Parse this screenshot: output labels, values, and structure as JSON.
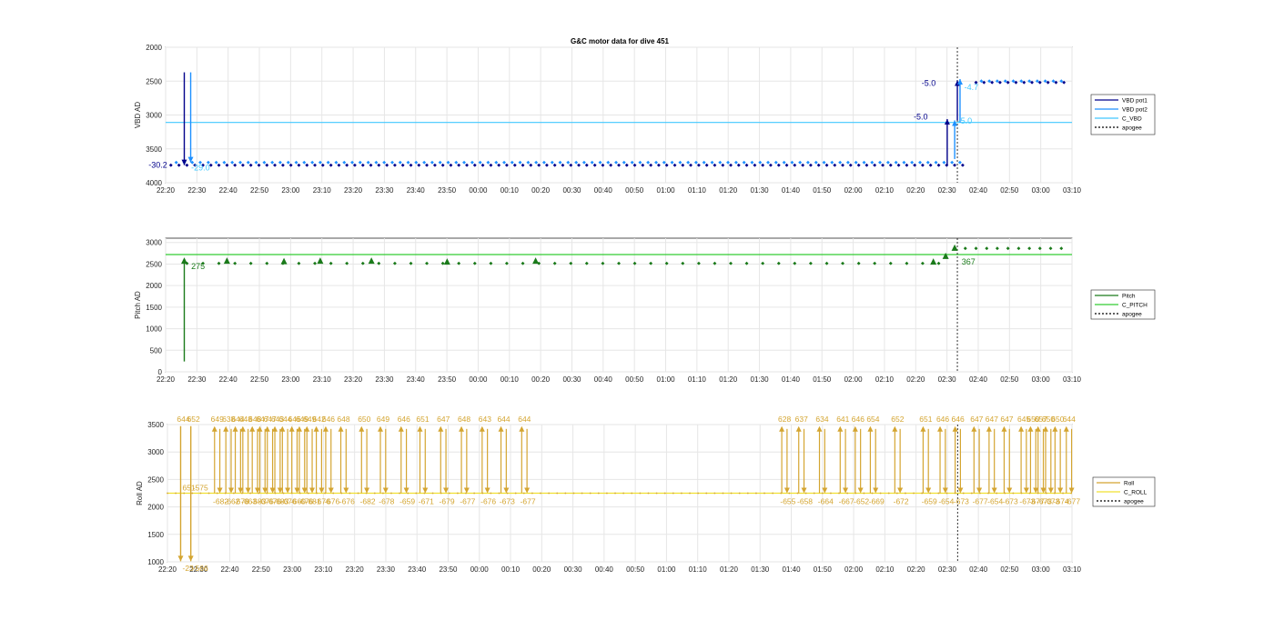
{
  "figure_title": "G&C motor data for dive 451",
  "colors": {
    "vbd_pot1": "#00008b",
    "vbd_pot2": "#1e90ff",
    "c_vbd": "#40c8ff",
    "pitch": "#1a7a1a",
    "c_pitch": "#33cc33",
    "roll": "#d4a531",
    "c_roll": "#f0e030",
    "apogee": "#000000"
  },
  "chart_data": [
    {
      "type": "scatter",
      "id": "vbd",
      "title": "G&C motor data for dive 451",
      "ylabel": "VBD AD",
      "ylim": [
        2000,
        4000
      ],
      "y_reversed": true,
      "y_ticks": [
        "2000",
        "2500",
        "3000",
        "3500",
        "4000"
      ],
      "x_ticks": [
        "22:20",
        "22:30",
        "22:40",
        "22:50",
        "23:00",
        "23:10",
        "23:20",
        "23:30",
        "23:40",
        "23:50",
        "00:00",
        "00:10",
        "00:20",
        "00:30",
        "00:40",
        "00:50",
        "01:00",
        "01:10",
        "01:20",
        "01:30",
        "01:40",
        "01:50",
        "02:00",
        "02:10",
        "02:20",
        "02:30",
        "02:40",
        "02:50",
        "03:00",
        "03:10"
      ],
      "xlim_minutes": [
        0,
        170
      ],
      "apogee_minutes": 148.5,
      "legend": [
        {
          "label": "VBD pot1",
          "color": "#00008b",
          "dash": ""
        },
        {
          "label": "VBD pot2",
          "color": "#1e90ff",
          "dash": ""
        },
        {
          "label": "C_VBD",
          "color": "#40c8ff",
          "dash": ""
        },
        {
          "label": "apogee",
          "color": "#000000",
          "dash": "2,2"
        }
      ],
      "hline": {
        "name": "C_VBD",
        "value": 3110,
        "color": "#40c8ff"
      },
      "series": [
        {
          "name": "VBD pot1",
          "color": "#00008b",
          "segments": [
            {
              "x": [
                1,
                150
              ],
              "y": 3730,
              "step": 1.5
            },
            {
              "x": [
                152,
                169
              ],
              "y": 2510,
              "step": 1.5
            }
          ]
        },
        {
          "name": "VBD pot2",
          "color": "#1e90ff",
          "segments": [
            {
              "x": [
                2,
                149
              ],
              "y": 3690,
              "step": 1.5
            },
            {
              "x": [
                153,
                169
              ],
              "y": 2490,
              "step": 1.5
            }
          ]
        }
      ],
      "arrows": [
        {
          "x": 3.5,
          "y0": 2370,
          "y1": 3740,
          "color": "#00008b",
          "head": "down"
        },
        {
          "x": 4.7,
          "y0": 2370,
          "y1": 3700,
          "color": "#1e90ff",
          "head": "down"
        },
        {
          "x": 146.6,
          "y0": 3740,
          "y1": 3060,
          "color": "#00008b",
          "head": "up"
        },
        {
          "x": 148.0,
          "y0": 3650,
          "y1": 3080,
          "color": "#1e90ff",
          "head": "up"
        },
        {
          "x": 148.5,
          "y0": 3080,
          "y1": 2490,
          "color": "#00008b",
          "head": "up"
        },
        {
          "x": 149.0,
          "y0": 3110,
          "y1": 2470,
          "color": "#1e90ff",
          "head": "up"
        }
      ],
      "labels": [
        {
          "text": "-30.2",
          "x": -3.2,
          "y": 3780,
          "color": "#00008b"
        },
        {
          "text": "-29.0",
          "x": 4.8,
          "y": 3820,
          "color": "#40c8ff"
        },
        {
          "text": "-5.0",
          "x": 140.3,
          "y": 3070,
          "color": "#00008b"
        },
        {
          "text": "-5.0",
          "x": 148.6,
          "y": 3130,
          "color": "#40c8ff"
        },
        {
          "text": "-5.0",
          "x": 141.8,
          "y": 2570,
          "color": "#00008b"
        },
        {
          "text": "-4.7",
          "x": 149.8,
          "y": 2630,
          "color": "#40c8ff"
        }
      ]
    },
    {
      "type": "scatter",
      "id": "pitch",
      "title": "",
      "ylabel": "Pitch AD",
      "ylim": [
        0,
        3100
      ],
      "y_reversed": false,
      "y_ticks": [
        "0",
        "500",
        "1000",
        "1500",
        "2000",
        "2500",
        "3000"
      ],
      "x_ticks": [
        "22:20",
        "22:30",
        "22:40",
        "22:50",
        "23:00",
        "23:10",
        "23:20",
        "23:30",
        "23:40",
        "23:50",
        "00:00",
        "00:10",
        "00:20",
        "00:30",
        "00:40",
        "00:50",
        "01:00",
        "01:10",
        "01:20",
        "01:30",
        "01:40",
        "01:50",
        "02:00",
        "02:10",
        "02:20",
        "02:30",
        "02:40",
        "02:50",
        "03:00",
        "03:10"
      ],
      "xlim_minutes": [
        0,
        170
      ],
      "apogee_minutes": 148.5,
      "legend": [
        {
          "label": "Pitch",
          "color": "#1a7a1a",
          "dash": ""
        },
        {
          "label": "C_PITCH",
          "color": "#33cc33",
          "dash": ""
        },
        {
          "label": "apogee",
          "color": "#000000",
          "dash": "2,2"
        }
      ],
      "hline": {
        "name": "C_PITCH",
        "value": 2720,
        "color": "#33cc33"
      },
      "series": [
        {
          "name": "Pitch",
          "color": "#1a7a1a",
          "segments": [
            {
              "x": [
                4,
                146
              ],
              "y": 2530,
              "step": 3
            },
            {
              "x": [
                150,
                169
              ],
              "y": 2880,
              "step": 2
            }
          ]
        }
      ],
      "triangles": [
        {
          "x": 3.5,
          "y": 2570
        },
        {
          "x": 11.5,
          "y": 2570
        },
        {
          "x": 22.2,
          "y": 2560
        },
        {
          "x": 29,
          "y": 2570
        },
        {
          "x": 38.6,
          "y": 2570
        },
        {
          "x": 52.8,
          "y": 2550
        },
        {
          "x": 69.4,
          "y": 2570
        },
        {
          "x": 144,
          "y": 2550
        },
        {
          "x": 146.3,
          "y": 2680
        },
        {
          "x": 148,
          "y": 2870
        }
      ],
      "arrows": [
        {
          "x": 3.5,
          "y0": 240,
          "y1": 2530,
          "color": "#1a7a1a",
          "head": "none"
        }
      ],
      "labels": [
        {
          "text": "275",
          "x": 4.8,
          "y": 2380,
          "color": "#1a7a1a"
        },
        {
          "text": "367",
          "x": 149.3,
          "y": 2490,
          "color": "#1a7a1a"
        }
      ]
    },
    {
      "type": "scatter",
      "id": "roll",
      "title": "",
      "ylabel": "Roll AD",
      "ylim": [
        1000,
        3500
      ],
      "y_reversed": false,
      "y_ticks": [
        "1000",
        "1500",
        "2000",
        "2500",
        "3000",
        "3500"
      ],
      "x_ticks": [
        "22:20",
        "22:30",
        "22:40",
        "22:50",
        "23:00",
        "23:10",
        "23:20",
        "23:30",
        "23:40",
        "23:50",
        "00:00",
        "00:10",
        "00:20",
        "00:30",
        "00:40",
        "00:50",
        "01:00",
        "01:10",
        "01:20",
        "01:30",
        "01:40",
        "01:50",
        "02:00",
        "02:10",
        "02:20",
        "02:30",
        "02:40",
        "02:50",
        "03:00",
        "03:10"
      ],
      "xlim_minutes": [
        0,
        170
      ],
      "apogee_minutes": 148.5,
      "legend": [
        {
          "label": "Roll",
          "color": "#d4a531",
          "dash": ""
        },
        {
          "label": "C_ROLL",
          "color": "#f0e030",
          "dash": ""
        },
        {
          "label": "apogee",
          "color": "#000000",
          "dash": "2,2"
        }
      ],
      "hline": {
        "name": "C_ROLL",
        "value": 2250,
        "color": "#f0e030"
      },
      "baseline": 2250,
      "roll_pairs": [
        {
          "x": 12.5,
          "pos": "649",
          "neg": "-682"
        },
        {
          "x": 15.5,
          "pos": "638",
          "neg": "-662"
        },
        {
          "x": 18,
          "pos": "644",
          "neg": "-678"
        },
        {
          "x": 20,
          "pos": "648",
          "neg": "-663"
        },
        {
          "x": 22.5,
          "pos": "648",
          "neg": "-683"
        },
        {
          "x": 24.5,
          "pos": "647",
          "neg": "-676"
        },
        {
          "x": 26.5,
          "pos": "647",
          "neg": "-676"
        },
        {
          "x": 28.5,
          "pos": "643",
          "neg": "-683"
        },
        {
          "x": 30.5,
          "pos": "644",
          "neg": "-676"
        },
        {
          "x": 33,
          "pos": "646",
          "neg": "-660"
        },
        {
          "x": 35,
          "pos": "649",
          "neg": "-676"
        },
        {
          "x": 37,
          "pos": "649",
          "neg": "-681"
        },
        {
          "x": 39.5,
          "pos": "642",
          "neg": "-676"
        },
        {
          "x": 42,
          "pos": "646",
          "neg": "-676"
        },
        {
          "x": 46,
          "pos": "648",
          "neg": "-676"
        },
        {
          "x": 51.5,
          "pos": "650",
          "neg": "-682"
        },
        {
          "x": 56.5,
          "pos": "649",
          "neg": "-678"
        },
        {
          "x": 62,
          "pos": "646",
          "neg": "-659"
        },
        {
          "x": 67,
          "pos": "651",
          "neg": "-671"
        },
        {
          "x": 72.5,
          "pos": "647",
          "neg": "-679"
        },
        {
          "x": 78,
          "pos": "648",
          "neg": "-677"
        },
        {
          "x": 83.5,
          "pos": "643",
          "neg": "-676"
        },
        {
          "x": 88.5,
          "pos": "644",
          "neg": "-673"
        },
        {
          "x": 94,
          "pos": "644",
          "neg": "-677"
        },
        {
          "x": 163,
          "pos": "628",
          "neg": "-655"
        },
        {
          "x": 167.5,
          "pos": "637",
          "neg": "-658"
        },
        {
          "x": 173,
          "pos": "634",
          "neg": "-664"
        },
        {
          "x": 178.5,
          "pos": "641",
          "neg": "-667"
        },
        {
          "x": 182.5,
          "pos": "646",
          "neg": "-652"
        },
        {
          "x": 186.5,
          "pos": "654",
          "neg": "-669"
        },
        {
          "x": 193,
          "pos": "652",
          "neg": "-672"
        },
        {
          "x": 200.5,
          "pos": "651",
          "neg": "-659"
        },
        {
          "x": 205,
          "pos": "646",
          "neg": "-654"
        },
        {
          "x": 209,
          "pos": "646",
          "neg": "-673"
        },
        {
          "x": 214,
          "pos": "647",
          "neg": "-677"
        },
        {
          "x": 218,
          "pos": "647",
          "neg": "-654"
        },
        {
          "x": 222,
          "pos": "647",
          "neg": "-673"
        },
        {
          "x": 226.5,
          "pos": "645",
          "neg": "-673"
        },
        {
          "x": 229,
          "pos": "650",
          "neg": "-677"
        },
        {
          "x": 231,
          "pos": "657",
          "neg": "-673"
        },
        {
          "x": 233,
          "pos": "650",
          "neg": "-673"
        },
        {
          "x": 235.5,
          "pos": "650",
          "neg": "-674"
        },
        {
          "x": 238.5,
          "pos": "644",
          "neg": "-677"
        }
      ],
      "early_events": [
        {
          "x": 3.5,
          "pos": "644",
          "neg": "-23",
          "mid": "651",
          "color": "#d4a531"
        },
        {
          "x": 6.2,
          "pos": "652",
          "neg": "-566",
          "mid": "-575",
          "color": "#d4a531"
        }
      ]
    }
  ]
}
